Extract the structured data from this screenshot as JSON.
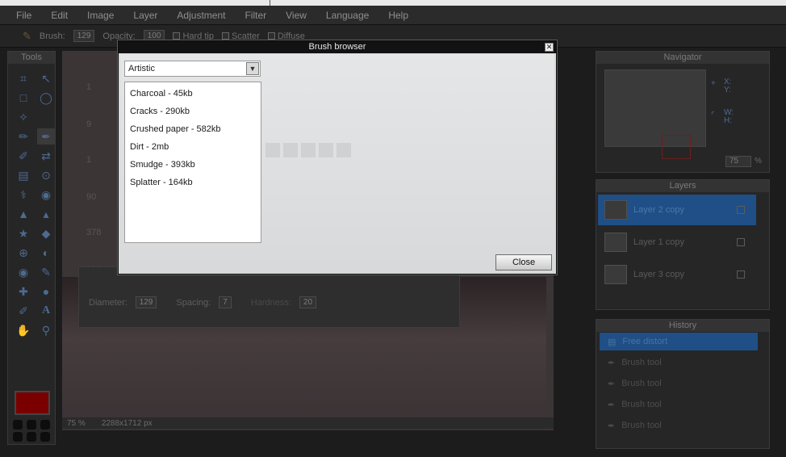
{
  "menubar": {
    "items": [
      "File",
      "Edit",
      "Image",
      "Layer",
      "Adjustment",
      "Filter",
      "View",
      "Language",
      "Help"
    ]
  },
  "options": {
    "brush_label": "Brush:",
    "brush_size": "129",
    "opacity_label": "Opacity:",
    "opacity_value": "100",
    "hard_tip": "Hard tip",
    "scatter": "Scatter",
    "diffuse": "Diffuse"
  },
  "tools": {
    "title": "Tools"
  },
  "brush_panel": {
    "side_numbers": [
      "1",
      "9",
      "1",
      "90",
      "378",
      "133"
    ],
    "diameter_label": "Diameter:",
    "diameter_value": "129",
    "spacing_label": "Spacing:",
    "spacing_value": "7",
    "hardness_label": "Hardness:",
    "hardness_value": "20"
  },
  "canvas": {
    "zoom": "75",
    "zoom_unit": "%",
    "dimensions": "2288x1712 px"
  },
  "navigator": {
    "title": "Navigator",
    "x_label": "X:",
    "y_label": "Y:",
    "w_label": "W:",
    "h_label": "H:",
    "zoom_value": "75",
    "zoom_unit": "%"
  },
  "layers": {
    "title": "Layers",
    "items": [
      {
        "name": "Layer 2 copy",
        "selected": true
      },
      {
        "name": "Layer 1 copy",
        "selected": false
      },
      {
        "name": "Layer 3 copy",
        "selected": false
      }
    ]
  },
  "history": {
    "title": "History",
    "items": [
      "Free distort",
      "Brush tool",
      "Brush tool",
      "Brush tool",
      "Brush tool"
    ]
  },
  "dialog": {
    "title": "Brush browser",
    "category": "Artistic",
    "brushes": [
      "Charcoal - 45kb",
      "Cracks - 290kb",
      "Crushed paper - 582kb",
      "Dirt - 2mb",
      "Smudge - 393kb",
      "Splatter - 164kb"
    ],
    "close_label": "Close"
  },
  "colors": {
    "accent": "#1f4f86",
    "foreground_color": "#7a0000"
  }
}
